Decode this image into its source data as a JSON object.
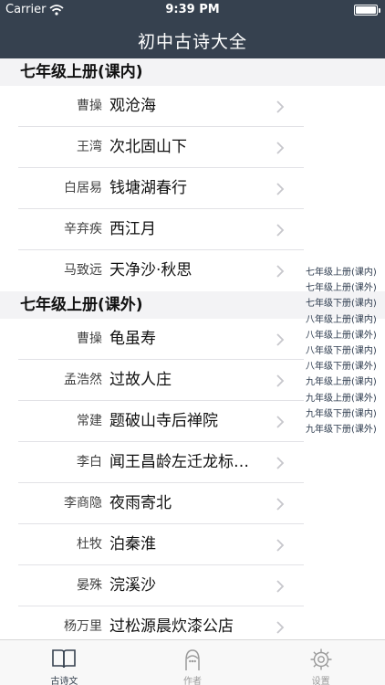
{
  "status": {
    "carrier": "Carrier",
    "time": "9:39 PM"
  },
  "nav": {
    "title": "初中古诗大全"
  },
  "sections": [
    {
      "header": "七年级上册(课内)",
      "rows": [
        {
          "author": "曹操",
          "title": "观沧海"
        },
        {
          "author": "王湾",
          "title": "次北固山下"
        },
        {
          "author": "白居易",
          "title": "钱塘湖春行"
        },
        {
          "author": "辛弃疾",
          "title": "西江月"
        },
        {
          "author": "马致远",
          "title": "天净沙·秋思"
        }
      ]
    },
    {
      "header": "七年级上册(课外)",
      "rows": [
        {
          "author": "曹操",
          "title": "龟虽寿"
        },
        {
          "author": "孟浩然",
          "title": "过故人庄"
        },
        {
          "author": "常建",
          "title": "题破山寺后禅院"
        },
        {
          "author": "李白",
          "title": "闻王昌龄左迁龙标遥…"
        },
        {
          "author": "李商隐",
          "title": "夜雨寄北"
        },
        {
          "author": "杜牧",
          "title": "泊秦淮"
        },
        {
          "author": "晏殊",
          "title": "浣溪沙"
        },
        {
          "author": "杨万里",
          "title": "过松源晨炊漆公店"
        }
      ]
    }
  ],
  "index": [
    "七年级上册(课内)",
    "七年级上册(课外)",
    "七年级下册(课内)",
    "八年级上册(课内)",
    "八年级上册(课外)",
    "八年级下册(课内)",
    "八年级下册(课外)",
    "九年级上册(课内)",
    "九年级上册(课外)",
    "九年级下册(课内)",
    "九年级下册(课外)"
  ],
  "tabs": [
    {
      "label": "古诗文",
      "icon": "book-icon",
      "active": true
    },
    {
      "label": "作者",
      "icon": "person-icon",
      "active": false
    },
    {
      "label": "设置",
      "icon": "gear-icon",
      "active": false
    }
  ],
  "colors": {
    "navbar": "#36414f",
    "section_bg": "#f3f3f5",
    "tab_active": "#36414f",
    "tab_inactive": "#9a9a9a"
  }
}
